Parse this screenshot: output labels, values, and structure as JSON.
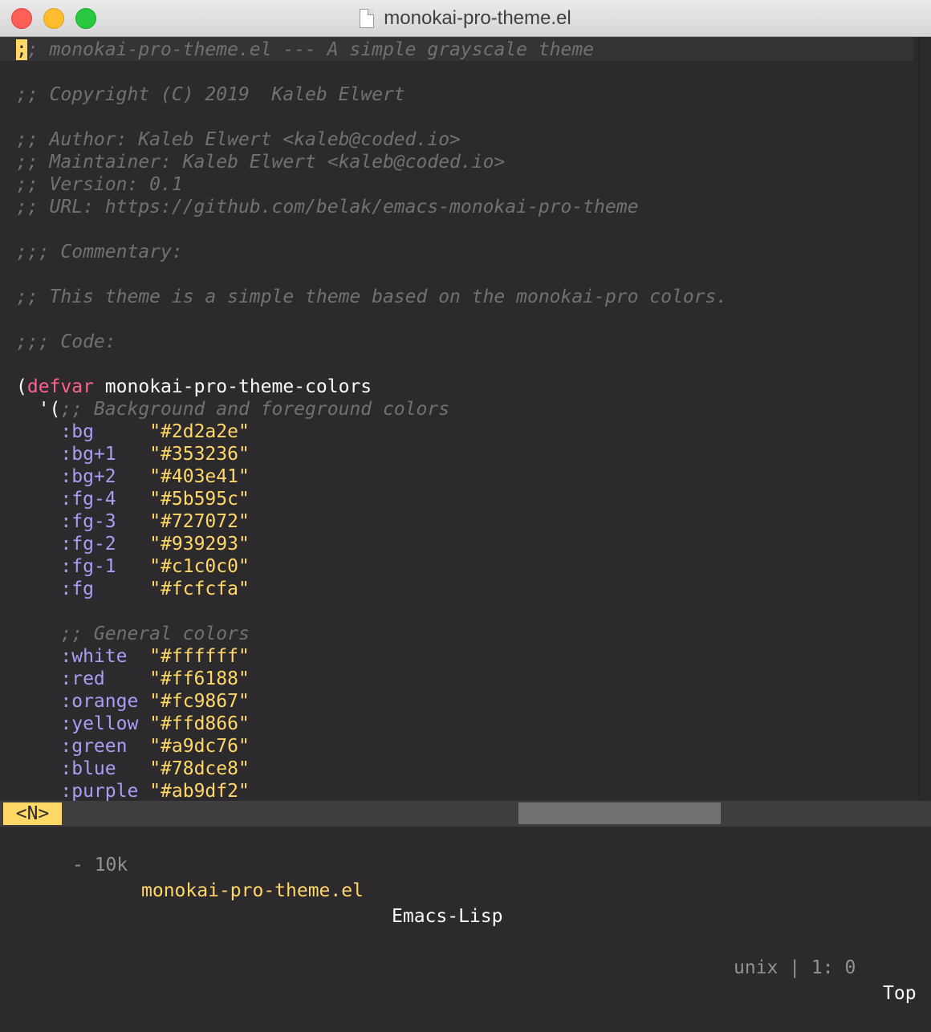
{
  "window": {
    "title": "monokai-pro-theme.el"
  },
  "editor": {
    "lines": [
      ";; monokai-pro-theme.el --- A simple grayscale theme",
      "",
      ";; Copyright (C) 2019  Kaleb Elwert",
      "",
      ";; Author: Kaleb Elwert <kaleb@coded.io>",
      ";; Maintainer: Kaleb Elwert <kaleb@coded.io>",
      ";; Version: 0.1",
      ";; URL: https://github.com/belak/emacs-monokai-pro-theme",
      "",
      ";;; Commentary:",
      "",
      ";; This theme is a simple theme based on the monokai-pro colors.",
      "",
      ";;; Code:",
      "",
      "(defvar monokai-pro-theme-colors",
      "  '(;; Background and foreground colors",
      "    :bg     \"#2d2a2e\"",
      "    :bg+1   \"#353236\"",
      "    :bg+2   \"#403e41\"",
      "    :fg-4   \"#5b595c\"",
      "    :fg-3   \"#727072\"",
      "    :fg-2   \"#939293\"",
      "    :fg-1   \"#c1c0c0\"",
      "    :fg     \"#fcfcfa\"",
      "",
      "    ;; General colors",
      "    :white  \"#ffffff\"",
      "    :red    \"#ff6188\"",
      "    :orange \"#fc9867\"",
      "    :yellow \"#ffd866\"",
      "    :green  \"#a9dc76\"",
      "    :blue   \"#78dce8\"",
      "    :purple \"#ab9df2\""
    ]
  },
  "modeline": {
    "state": "<N>",
    "size": "- 10k",
    "filename": "monokai-pro-theme.el",
    "mode": "Emacs-Lisp",
    "encoding": "unix | 1: 0",
    "position": "Top"
  },
  "colors": {
    "background": "#2d2a2e",
    "comment": "#727072",
    "keyword": "#ff6188",
    "symbol": "#ab9df2",
    "string": "#ffd866",
    "foreground": "#fcfcfa"
  }
}
